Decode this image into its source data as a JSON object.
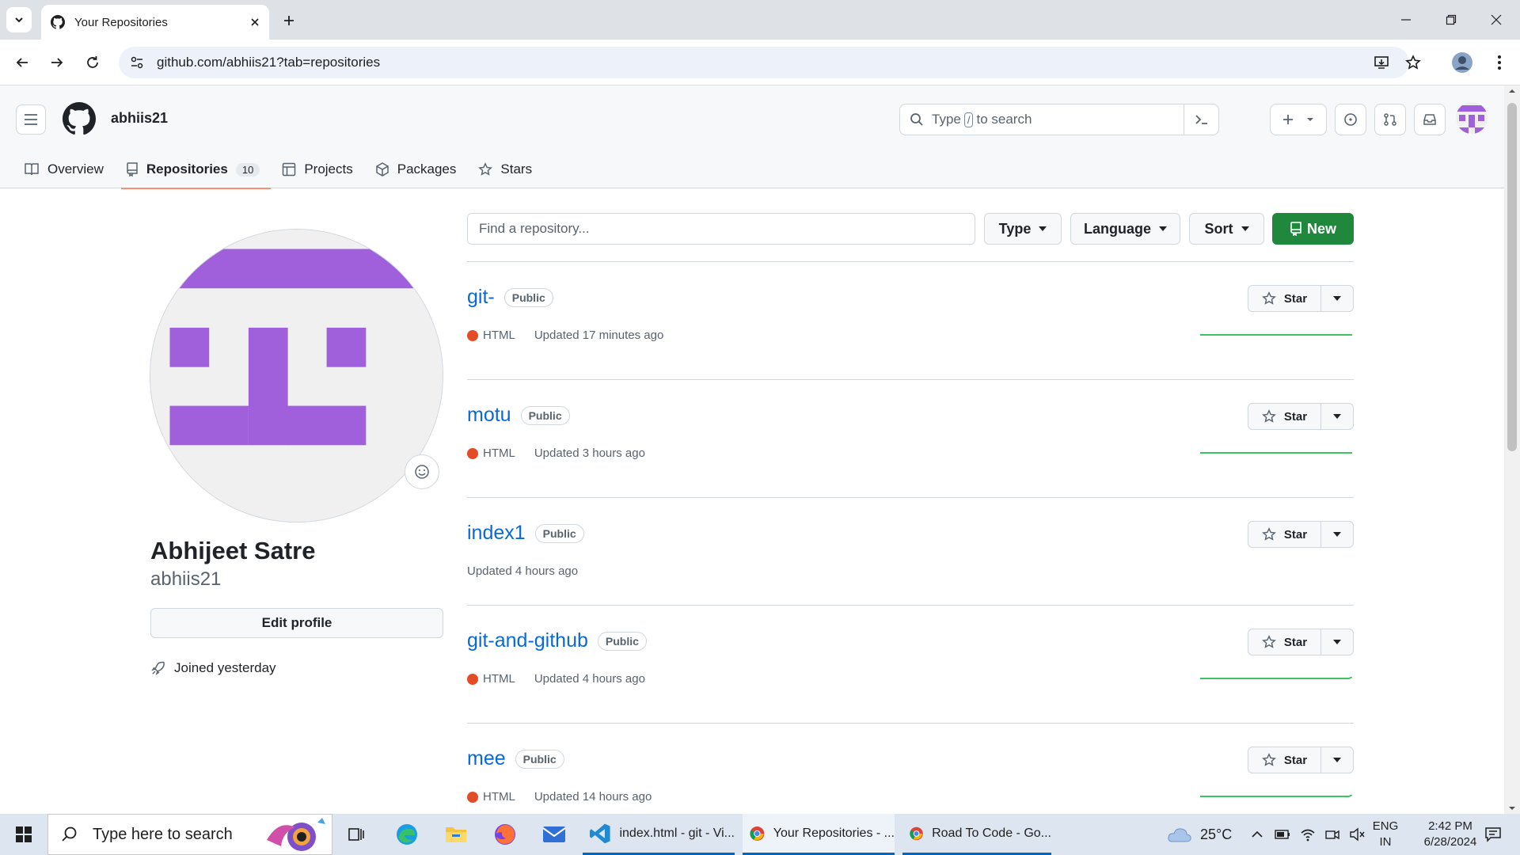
{
  "browser": {
    "tab_title": "Your Repositories",
    "url": "github.com/abhiis21?tab=repositories"
  },
  "header": {
    "username": "abhiis21",
    "search_prefix": "Type",
    "search_key": "/",
    "search_suffix": "to search"
  },
  "nav": {
    "overview": "Overview",
    "repositories": "Repositories",
    "repositories_count": "10",
    "projects": "Projects",
    "packages": "Packages",
    "stars": "Stars"
  },
  "profile": {
    "full_name": "Abhijeet Satre",
    "login": "abhiis21",
    "edit_label": "Edit profile",
    "joined": "Joined yesterday"
  },
  "filters": {
    "find_placeholder": "Find a repository...",
    "type_label": "Type",
    "language_label": "Language",
    "sort_label": "Sort",
    "new_label": "New"
  },
  "repos": [
    {
      "name": "git-",
      "visibility": "Public",
      "language": "HTML",
      "updated": "Updated 17 minutes ago",
      "star_label": "Star"
    },
    {
      "name": "motu",
      "visibility": "Public",
      "language": "HTML",
      "updated": "Updated 3 hours ago",
      "star_label": "Star"
    },
    {
      "name": "index1",
      "visibility": "Public",
      "language": "",
      "updated": "Updated 4 hours ago",
      "star_label": "Star"
    },
    {
      "name": "git-and-github",
      "visibility": "Public",
      "language": "HTML",
      "updated": "Updated 4 hours ago",
      "star_label": "Star"
    },
    {
      "name": "mee",
      "visibility": "Public",
      "language": "HTML",
      "updated": "Updated 14 hours ago",
      "star_label": "Star"
    }
  ],
  "colors": {
    "accent_green": "#1f883d",
    "link_blue": "#0969da",
    "html_lang": "#e34c26",
    "avatar_purple": "#a05fdb"
  },
  "taskbar": {
    "search_placeholder": "Type here to search",
    "app_vscode": "index.html - git - Vi...",
    "app_chrome_repos": "Your Repositories - ...",
    "app_chrome_road": "Road To Code - Go...",
    "weather": "25°C",
    "lang_line1": "ENG",
    "lang_line2": "IN",
    "time": "2:42 PM",
    "date": "6/28/2024"
  }
}
